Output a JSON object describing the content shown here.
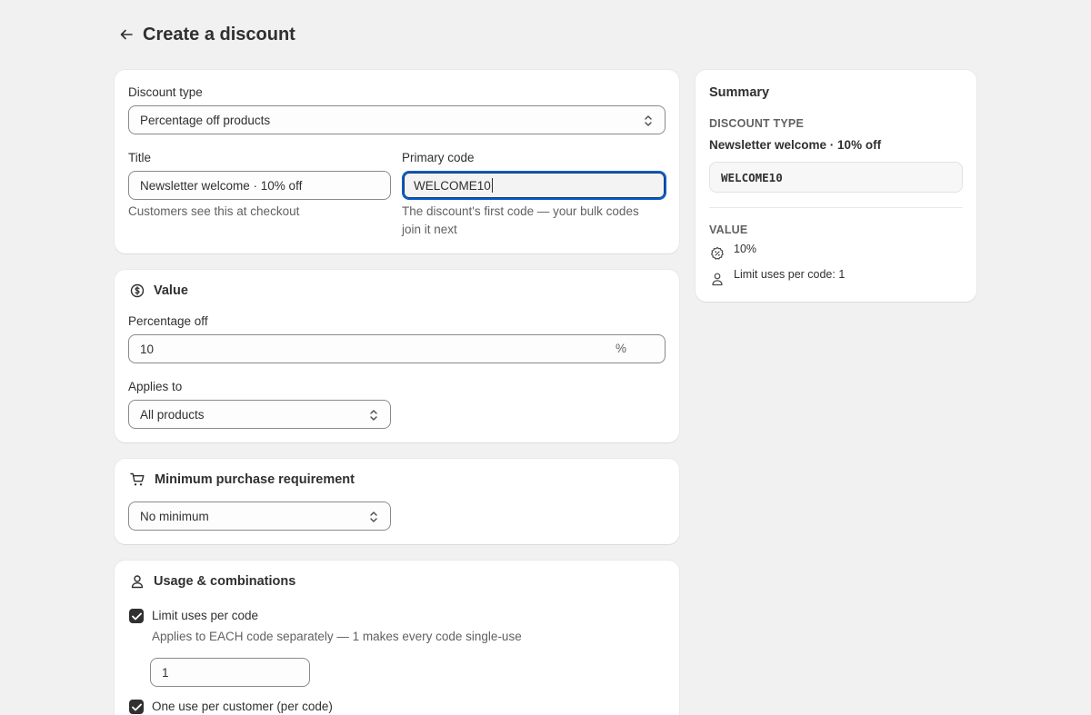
{
  "page": {
    "title": "Create a discount"
  },
  "discount_type": {
    "label": "Discount type",
    "value": "Percentage off products"
  },
  "title_field": {
    "label": "Title",
    "value": "Newsletter welcome · 10% off",
    "help": "Customers see this at checkout"
  },
  "primary_code": {
    "label": "Primary code",
    "value": "WELCOME10",
    "help_line1": "The discount's first code — your bulk codes",
    "help_line2": "join it next"
  },
  "value_section": {
    "title": "Value",
    "percentage_label": "Percentage off",
    "percentage_value": "10",
    "percentage_suffix": "%",
    "applies_label": "Applies to",
    "applies_value": "All products"
  },
  "min_purchase": {
    "title": "Minimum purchase requirement",
    "value": "No minimum"
  },
  "usage": {
    "title": "Usage & combinations",
    "limit_label": "Limit uses per code",
    "limit_help": "Applies to EACH code separately — 1 makes every code single-use",
    "limit_value": "1",
    "one_per_customer_label": "One use per customer (per code)"
  },
  "summary": {
    "heading": "Summary",
    "type_caption": "DISCOUNT TYPE",
    "type_title": "Newsletter welcome · 10% off",
    "code": "WELCOME10",
    "value_caption": "VALUE",
    "value_text": "10%",
    "limit_text": "Limit uses per code: 1"
  }
}
